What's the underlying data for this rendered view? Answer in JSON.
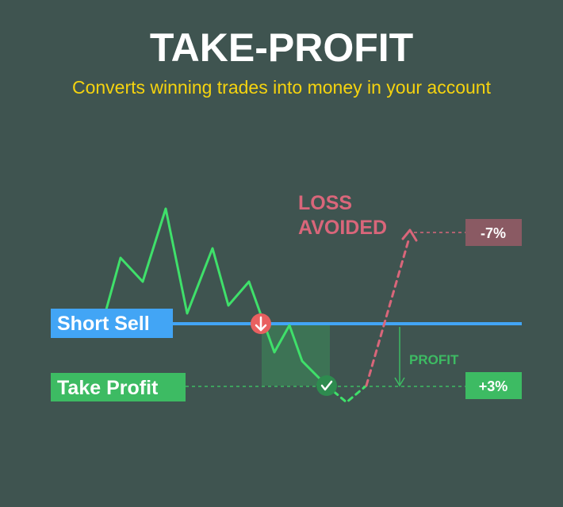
{
  "title": "TAKE-PROFIT",
  "subtitle": "Converts winning trades into money in your account",
  "labels": {
    "short_sell": "Short Sell",
    "take_profit": "Take Profit",
    "loss_avoided_line1": "LOSS",
    "loss_avoided_line2": "AVOIDED",
    "profit": "PROFIT",
    "loss_pct": "-7%",
    "profit_pct": "+3%"
  },
  "icons": {
    "entry": "arrow-down-icon",
    "exit": "check-icon"
  },
  "colors": {
    "background": "#3f5450",
    "title": "#ffffff",
    "subtitle": "#f5d30f",
    "price_line": "#3fe06a",
    "short_sell": "#42a5f5",
    "take_profit": "#3dbb63",
    "loss": "#d9667a",
    "loss_badge": "#8a5a63",
    "entry_marker": "#e96060"
  }
}
